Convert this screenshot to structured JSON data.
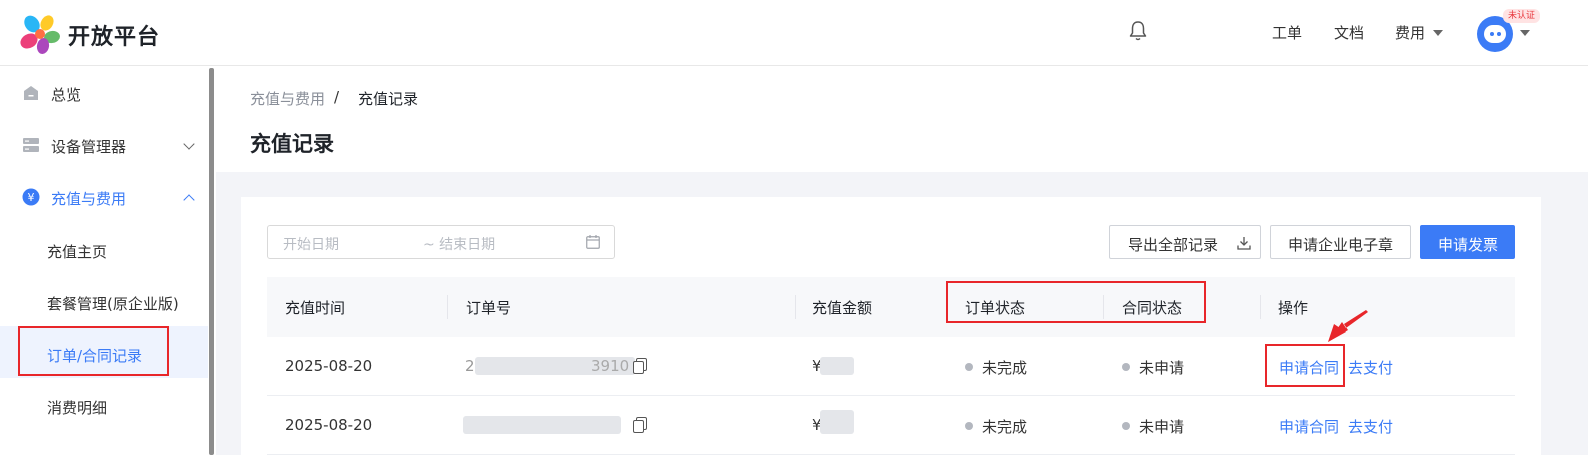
{
  "header": {
    "brand": "开放平台",
    "nav": {
      "gongdan": "工单",
      "wendang": "文档",
      "feiyong": "费用"
    },
    "avatar_badge": "未认证",
    "icons": [
      "bell-icon",
      "avatar-icon"
    ]
  },
  "sidebar": {
    "items": [
      {
        "label": "总览",
        "icon": "home-icon"
      },
      {
        "label": "设备管理器",
        "icon": "device-icon"
      },
      {
        "label": "充值与费用",
        "icon": "yen-icon"
      },
      {
        "label": "充值主页"
      },
      {
        "label": "套餐管理(原企业版)"
      },
      {
        "label": "订单/合同记录"
      },
      {
        "label": "消费明细"
      }
    ]
  },
  "breadcrumb": {
    "parent": "充值与费用",
    "separator": "/",
    "current": "充值记录"
  },
  "page_title": "充值记录",
  "filters": {
    "start_placeholder": "开始日期",
    "end_placeholder": "~ 结束日期"
  },
  "toolbar": {
    "export_label": "导出全部记录",
    "seal_label": "申请企业电子章",
    "invoice_label": "申请发票"
  },
  "table": {
    "columns": [
      "充值时间",
      "订单号",
      "充值金额",
      "订单状态",
      "合同状态",
      "操作"
    ],
    "rows": [
      {
        "time": "2025-08-20",
        "order_no_visible": "2",
        "order_no_tail": "3910",
        "amount_prefix": "¥",
        "order_status": "未完成",
        "contract_status": "未申请",
        "action_contract": "申请合同",
        "action_pay": "去支付"
      },
      {
        "time": "2025-08-20",
        "order_no_visible": "",
        "order_no_tail": "",
        "amount_prefix": "¥",
        "order_status": "未完成",
        "contract_status": "未申请",
        "action_contract": "申请合同",
        "action_pay": "去支付"
      }
    ]
  },
  "colors": {
    "accent": "#3b7bf6",
    "annotation": "#e8262a",
    "page_bg": "#f3f4f8"
  }
}
